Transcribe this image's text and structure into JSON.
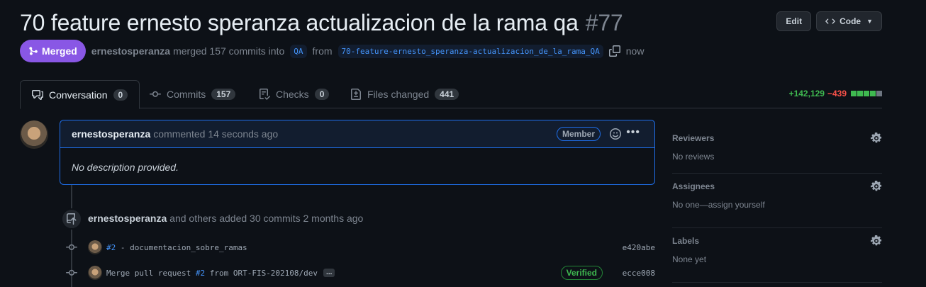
{
  "header": {
    "title": "70 feature ernesto speranza actualizacion de la rama qa",
    "number": "#77",
    "edit_label": "Edit",
    "code_label": "Code"
  },
  "meta": {
    "status": "Merged",
    "author": "ernestosperanza",
    "merged_text": "merged 157 commits into",
    "base_branch": "QA",
    "from_text": "from",
    "head_branch": "70-feature-ernesto_speranza-actualizacion_de_la_rama_QA",
    "time": "now"
  },
  "tabs": [
    {
      "label": "Conversation",
      "count": "0",
      "icon": "comment-discussion-icon"
    },
    {
      "label": "Commits",
      "count": "157",
      "icon": "git-commit-icon"
    },
    {
      "label": "Checks",
      "count": "0",
      "icon": "checklist-icon"
    },
    {
      "label": "Files changed",
      "count": "441",
      "icon": "file-diff-icon"
    }
  ],
  "diffstat": {
    "additions": "+142,129",
    "deletions": "−439"
  },
  "comment": {
    "author": "ernestosperanza",
    "action": "commented 14 seconds ago",
    "badge": "Member",
    "body": "No description provided."
  },
  "timeline": {
    "event_author": "ernestosperanza",
    "event_text": "and others added 30 commits 2 months ago",
    "commits": [
      {
        "ref": "#2",
        "message": "- documentacion_sobre_ramas",
        "sha": "e420abe",
        "verified": ""
      },
      {
        "ref_prefix": "Merge pull request ",
        "ref": "#2",
        "message": "from ORT-FIS-202108/dev",
        "sha": "ecce008",
        "verified": "Verified",
        "ellipsis": "..."
      }
    ]
  },
  "sidebar": {
    "sections": [
      {
        "title": "Reviewers",
        "value": "No reviews"
      },
      {
        "title": "Assignees",
        "value": "No one—assign yourself"
      },
      {
        "title": "Labels",
        "value": "None yet"
      }
    ]
  },
  "colors": {
    "merged": "#8957e5",
    "accent_blue": "#1f6feb",
    "additions": "#3fb950",
    "deletions": "#f85149"
  }
}
